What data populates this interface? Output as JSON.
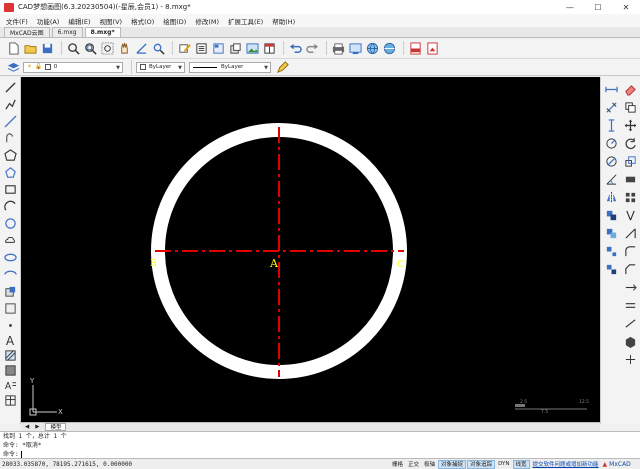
{
  "window": {
    "title": "CAD梦想画图(6.3.20230504)(-星辰,会员1) - 8.mxg*",
    "minimize": "—",
    "maximize": "☐",
    "close": "✕"
  },
  "menu": [
    "文件(F)",
    "功能(A)",
    "编辑(E)",
    "视图(V)",
    "格式(O)",
    "绘图(D)",
    "修改(M)",
    "扩展工具(E)",
    "帮助(H)"
  ],
  "tabs": [
    {
      "label": "MxCAD云图",
      "active": false
    },
    {
      "label": "6.mxg",
      "active": false
    },
    {
      "label": "8.mxg*",
      "active": true
    }
  ],
  "layer_bar": {
    "layer_value": "0",
    "color_value": "ByLayer",
    "linetype_value": "ByLayer"
  },
  "drawing": {
    "center_label": "A",
    "left_label": "B",
    "right_label": "C",
    "colors": {
      "background": "#000000",
      "ring": "#ffffff",
      "centerline": "#e00000",
      "label": "#ffff00"
    },
    "ucs_y": "Y",
    "ucs_x": "X",
    "scale_left": "2.5",
    "scale_right": "12.5",
    "scale_mid": "7.5"
  },
  "model_tabs": {
    "model_label": "模型"
  },
  "command": {
    "line1": "找到 1 个，总计 1 个",
    "line2": "命令: *取消*",
    "prompt": "命令:"
  },
  "status": {
    "coords": "28033.035870,  78195.271615,  0.000000",
    "buttons": [
      {
        "label": "栅格",
        "on": false
      },
      {
        "label": "正交",
        "on": false
      },
      {
        "label": "极轴",
        "on": false
      },
      {
        "label": "对象捕捉",
        "on": true
      },
      {
        "label": "对象追踪",
        "on": true
      },
      {
        "label": "DYN",
        "on": false
      },
      {
        "label": "线宽",
        "on": true
      }
    ],
    "feedback": "提交软件问题或增加新功能",
    "brand": "MxCAD"
  }
}
